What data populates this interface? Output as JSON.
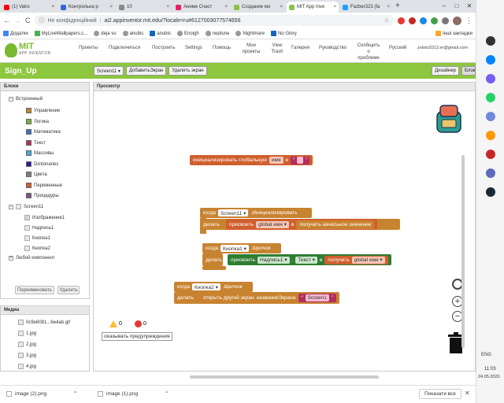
{
  "browser": {
    "tabs": [
      {
        "label": "(1) Vairo",
        "color": "#ff0000"
      },
      {
        "label": "Контрольна р",
        "color": "#3367d6"
      },
      {
        "label": "10",
        "color": "#555"
      },
      {
        "label": "Аниме Счаст",
        "color": "#e91e63"
      },
      {
        "label": "Создание мо",
        "color": "#8bc34a"
      },
      {
        "label": "MIT App Inve",
        "color": "#8bc34a"
      },
      {
        "label": "Fazber323 (fa",
        "color": "#1da1f2"
      }
    ],
    "tab_close": "×",
    "new_tab": "+",
    "window": {
      "minimize": "–",
      "maximize": "□",
      "close": "✕"
    },
    "nav": {
      "back": "←",
      "forward": "→",
      "reload": "C"
    },
    "security": "Не конфіденційний",
    "url": "ai2.appinventor.mit.edu/?locale=ru#6127003077574656",
    "bookmarks": [
      {
        "label": "Додатки",
        "color": "#4285f4"
      },
      {
        "label": "MyLiveWallpapers.c...",
        "color": "#4caf50"
      },
      {
        "label": "deja vu",
        "color": "#555"
      },
      {
        "label": "anubis",
        "color": "#555"
      },
      {
        "label": "anubis",
        "color": "#1565c0"
      },
      {
        "label": "Enoigh",
        "color": "#555"
      },
      {
        "label": "neptune",
        "color": "#555"
      },
      {
        "label": "Nightmare",
        "color": "#555"
      },
      {
        "label": "No Glory",
        "color": "#1565c0"
      }
    ],
    "other_bookmarks": "Інші закладки"
  },
  "ai": {
    "logo_title": "MIT",
    "logo_sub": "APP INVENTOR",
    "menu": [
      "Проекты",
      "Подключиться",
      "Построить",
      "Settings",
      "Помощь",
      "Мои проекты",
      "View Trash",
      "Галерея",
      "Руководство",
      "Сообщить о проблеме",
      "Русский",
      "zoloto2013.er@gmail.com"
    ],
    "screen_name": "Sign_Up",
    "screen_select": "Screen11 ▾",
    "add_screen": "ДобавитьЭкран",
    "remove_screen": "Удалить экран",
    "designer": "Дизайнер",
    "blocks_btn": "Блоки"
  },
  "blocks_panel": {
    "title": "Блоки",
    "builtin": "Встроенный",
    "builtin_items": [
      {
        "label": "Управление",
        "color": "#c88330"
      },
      {
        "label": "Логика",
        "color": "#77ab41"
      },
      {
        "label": "Математика",
        "color": "#3f71b5"
      },
      {
        "label": "Текст",
        "color": "#b32d5e"
      },
      {
        "label": "Массивы",
        "color": "#49a6d4"
      },
      {
        "label": "Dictionaries",
        "color": "#2d1799"
      },
      {
        "label": "Цвета",
        "color": "#7d7d7d"
      },
      {
        "label": "Переменные",
        "color": "#d05f2d"
      },
      {
        "label": "Процедуры",
        "color": "#7c5385"
      }
    ],
    "screen": "Screen11",
    "components": [
      "Изображение1",
      "Надпись1",
      "Кнопка1",
      "Кнопка2"
    ],
    "any_component": "Любой компонент",
    "rename": "Переименовать",
    "delete": "Удалить"
  },
  "media": {
    "title": "Медиа",
    "files": [
      "0c9e6081...6e4ab.gif",
      "1.jpg",
      "2.jpg",
      "3.jpg",
      "4.jpg",
      "5.jpg"
    ]
  },
  "viewer": {
    "title": "Просмотр",
    "global_init": {
      "text": "инициализировать глобальную",
      "name": "имя",
      "to": "в"
    },
    "event1": {
      "when": "когда",
      "component": "Screen11 ▾",
      "event": ".Инициализировать",
      "do": "делать",
      "set": "присвоить",
      "var": "global имя ▾",
      "to": "в",
      "call": "получить начальное значение"
    },
    "event2": {
      "when": "когда",
      "component": "Кнопка1 ▾",
      "event": ".Щелчок",
      "do": "делать",
      "set": "присвоить",
      "comp": "Надпись1 ▾",
      "prop": "Текст ▾",
      "to": "в",
      "get": "получить",
      "var": "global имя ▾"
    },
    "event3": {
      "when": "когда",
      "component": "Кнопка2 ▾",
      "event": ".Щелчок",
      "do": "делать",
      "open": "открыть другой экран",
      "param": "названиеЭкрана",
      "screen": "Screen1"
    },
    "warnings": "0",
    "errors": "0",
    "warn_toggle": "оказывать предупреждения",
    "zoom_in": "+",
    "zoom_out": "−"
  },
  "taskbar": {
    "downloads": [
      {
        "name": "image (2).png"
      },
      {
        "name": "image (1).png"
      }
    ],
    "show_all": "Показати все",
    "close": "✕",
    "lang": "ENG",
    "time": "11:03",
    "date": "24.05.2020"
  }
}
